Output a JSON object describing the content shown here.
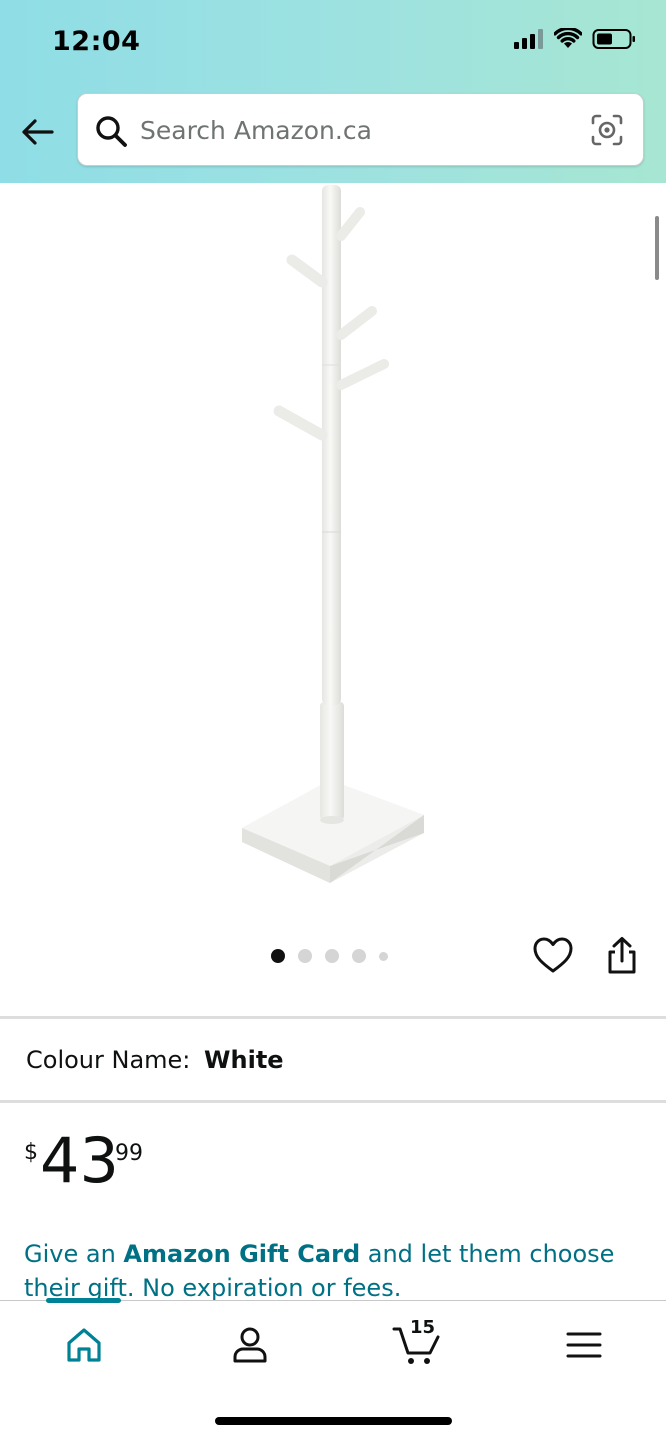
{
  "status_bar": {
    "time": "12:04"
  },
  "search": {
    "placeholder": "Search Amazon.ca"
  },
  "icons": {
    "back": "back-arrow-icon",
    "search": "search-icon",
    "camera": "camera-lens-icon",
    "wishlist": "heart-icon",
    "share": "share-icon",
    "home": "home-icon",
    "account": "person-icon",
    "cart": "cart-icon",
    "menu": "hamburger-menu-icon"
  },
  "product": {
    "image_count": 5,
    "active_image": 1
  },
  "variation": {
    "label": "Colour Name:",
    "value": "White"
  },
  "price": {
    "symbol": "$",
    "whole": "43",
    "fraction": "99"
  },
  "promo": {
    "prefix": "Give an ",
    "highlight": "Amazon Gift Card",
    "suffix": " and let them choose their gift. No expiration or fees."
  },
  "bottom_nav": {
    "active_tab": "home",
    "cart_count": "15"
  },
  "colors": {
    "accent": "#007185",
    "nav_active": "#008296",
    "header_gradient_start": "#8fdde6",
    "header_gradient_end": "#a6e6d2"
  }
}
